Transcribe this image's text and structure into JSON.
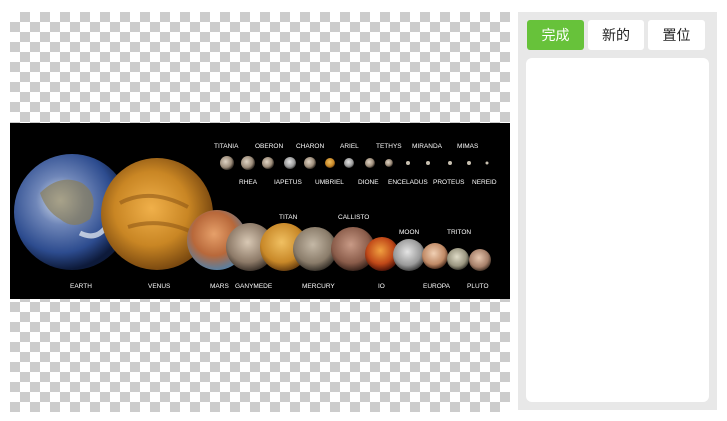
{
  "toolbar": {
    "done_label": "完成",
    "new_label": "新的",
    "reset_label": "置位"
  },
  "colors": {
    "accent": "#67c23a",
    "panel_bg": "#e8e8e8",
    "image_bg": "#000000"
  },
  "image_labels": {
    "top_row": [
      "TITANIA",
      "OBERON",
      "CHARON",
      "ARIEL",
      "TETHYS",
      "MIRANDA",
      "MIMAS"
    ],
    "second_row": [
      "RHEA",
      "IAPETUS",
      "UMBRIEL",
      "DIONE",
      "ENCELADUS",
      "PROTEUS",
      "NEREID"
    ],
    "mid_labels": [
      "TITAN",
      "CALLISTO",
      "MOON",
      "TRITON"
    ],
    "bottom_row": [
      "EARTH",
      "VENUS",
      "MARS",
      "GANYMEDE",
      "MERCURY",
      "IO",
      "EUROPA",
      "PLUTO"
    ]
  }
}
